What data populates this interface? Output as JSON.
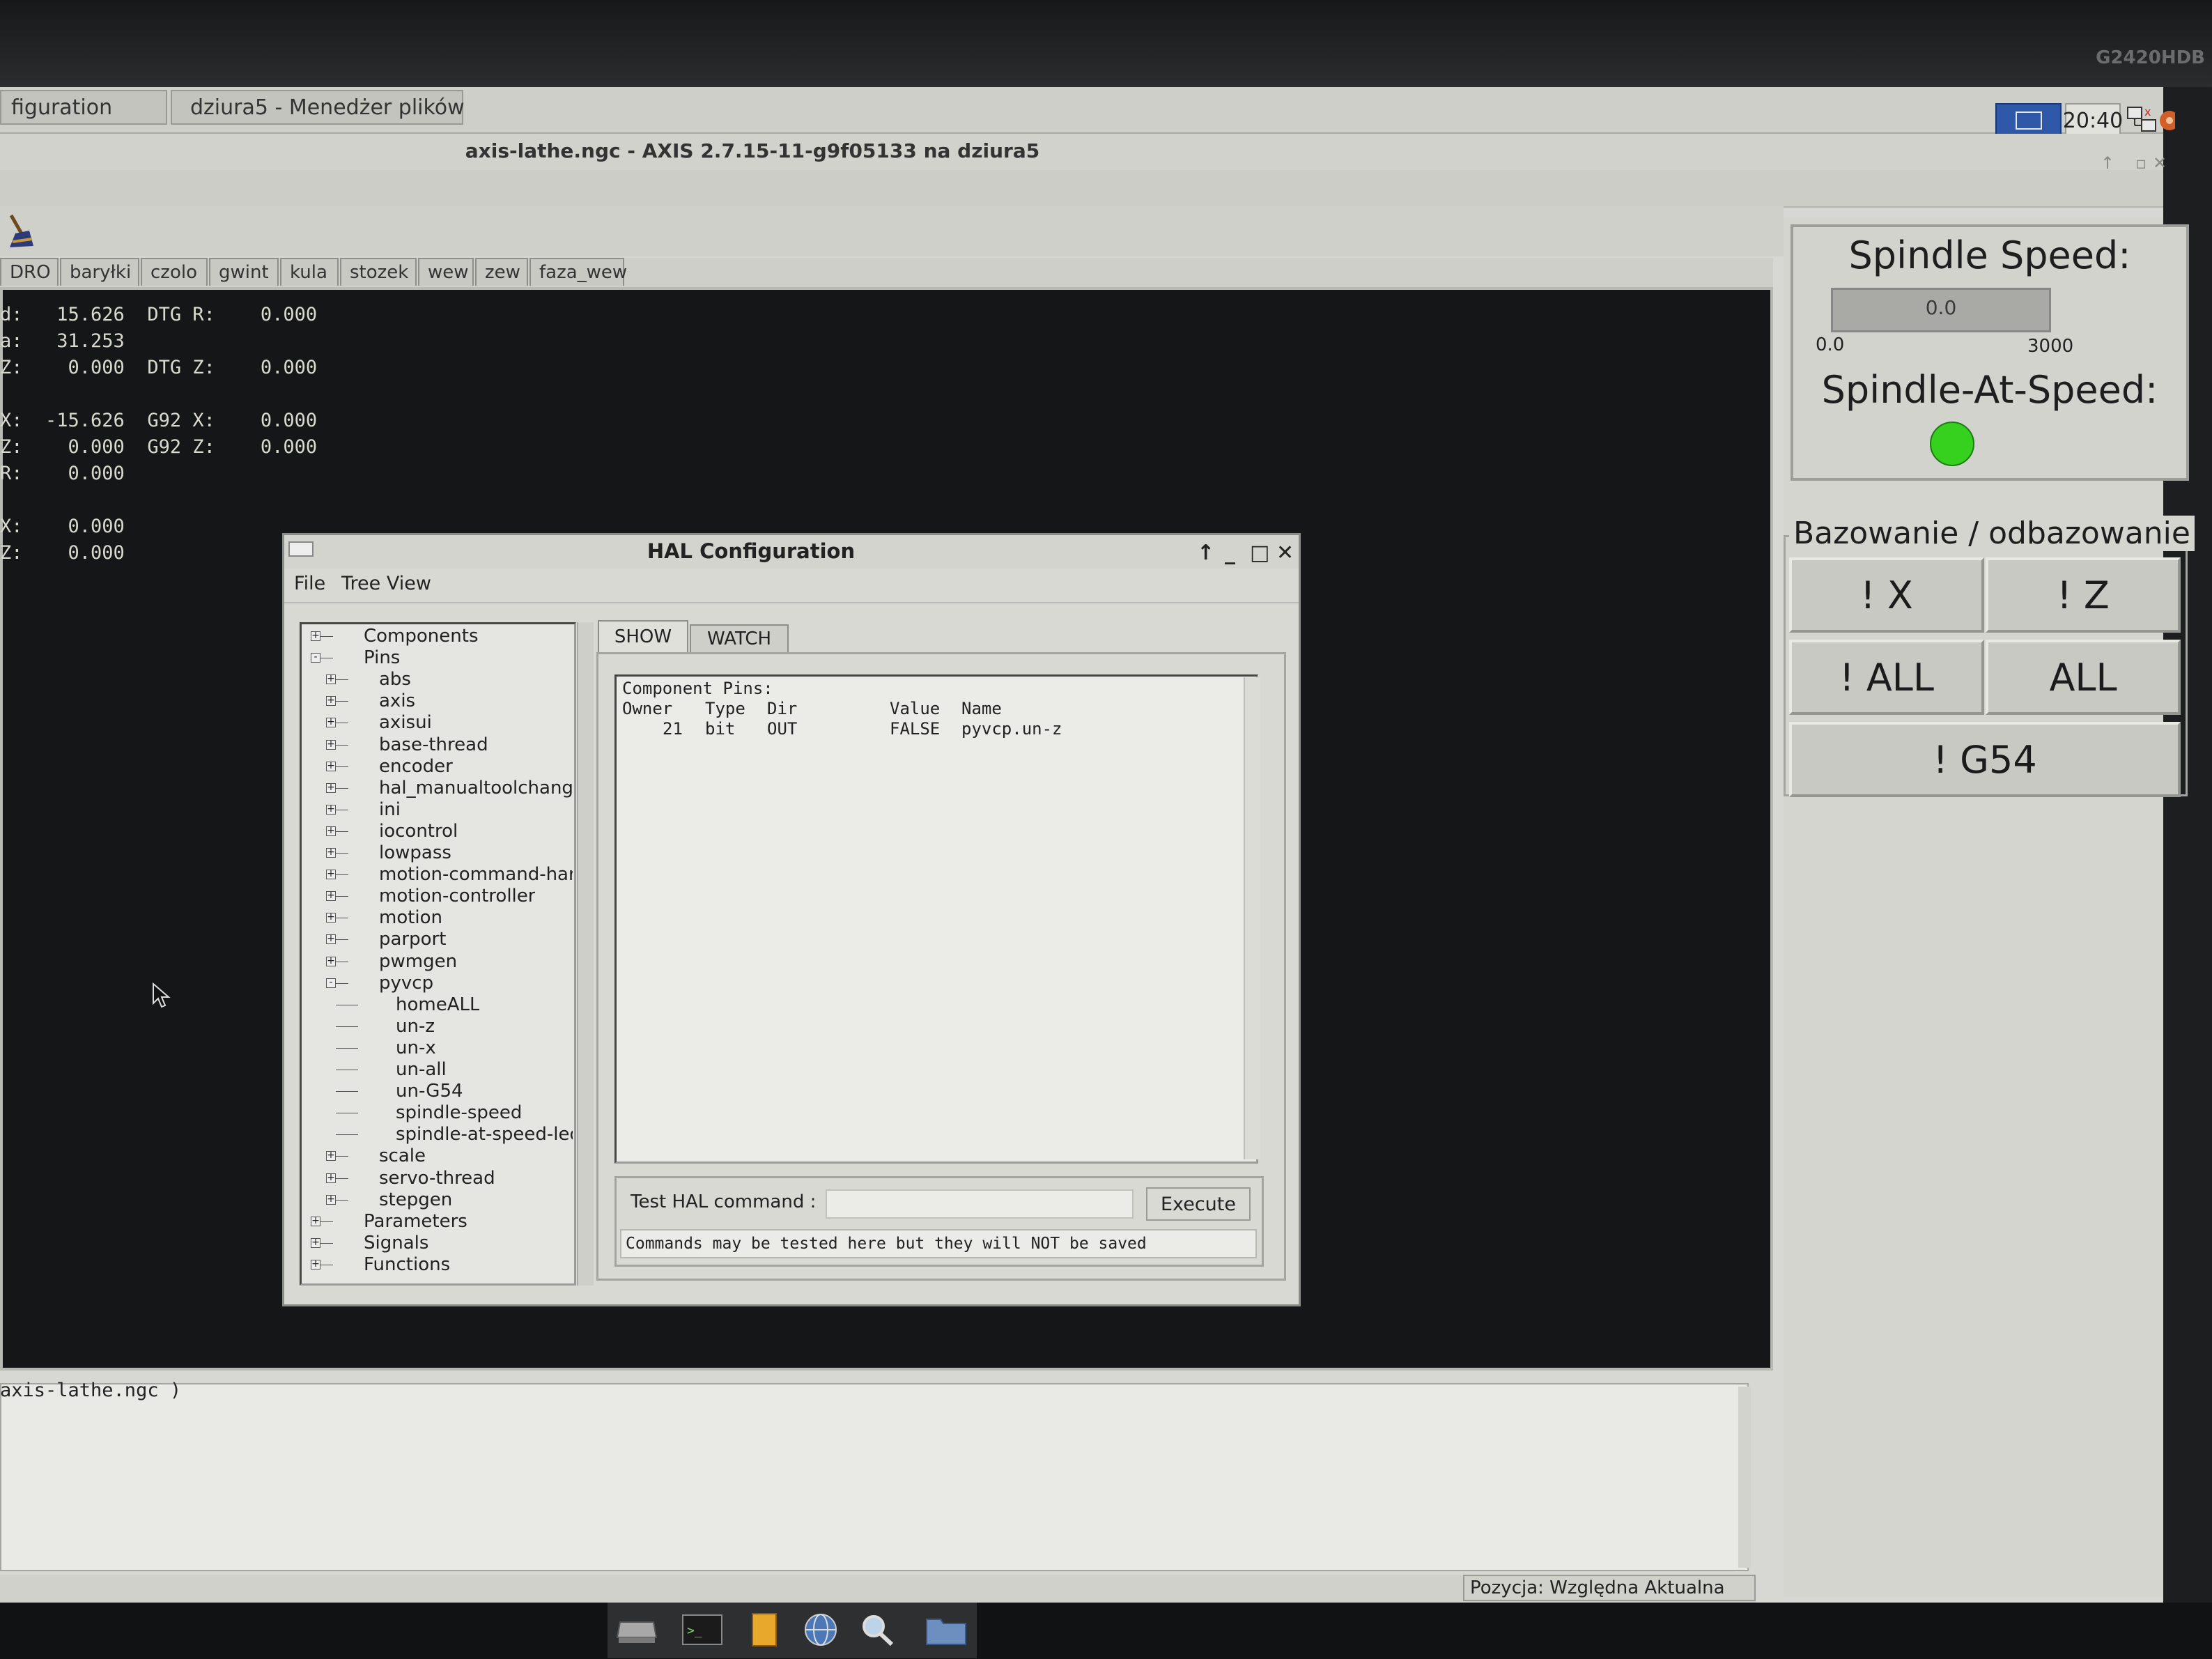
{
  "monitor": {
    "model_label": "G2420HDB"
  },
  "top_panel": {
    "tasks": [
      {
        "label": "figuration",
        "active": false
      },
      {
        "label": "dziura5 - Menedżer plików",
        "active": false
      }
    ],
    "clock": "20:40"
  },
  "axis": {
    "window_title": "axis-lathe.ngc - AXIS 2.7.15-11-g9f05133 na dziura5",
    "tabs": [
      "DRO",
      "baryłki",
      "czolo",
      "gwint",
      "kula",
      "stozek",
      "wew",
      "zew",
      "faza_wew"
    ],
    "dro_lines": [
      "d:   15.626  DTG R:    0.000",
      "a:   31.253",
      "Z:    0.000  DTG Z:    0.000",
      "",
      "X:  -15.626  G92 X:    0.000",
      "Z:    0.000  G92 Z:    0.000",
      "R:    0.000",
      "",
      "X:    0.000",
      "Z:    0.000"
    ],
    "gcode_text": "axis-lathe.ngc )",
    "status_position": "Pozycja: Względna Aktualna"
  },
  "pyvcp": {
    "spindle_speed_title": "Spindle Speed:",
    "spindle_speed_value": "0.0",
    "spindle_speed_min": "0.0",
    "spindle_speed_max": "3000",
    "spindle_at_speed_title": "Spindle-At-Speed:",
    "led_color": "#36d01e",
    "homing_title": "Bazowanie / odbazowanie",
    "buttons": {
      "unhome_x": "! X",
      "unhome_z": "! Z",
      "unhome_all": "! ALL",
      "home_all": "ALL",
      "g54": "! G54"
    }
  },
  "hal": {
    "title": "HAL Configuration",
    "menu": [
      "File",
      "Tree View"
    ],
    "tabs": {
      "show": "SHOW",
      "watch": "WATCH"
    },
    "tree": [
      {
        "label": "Components",
        "level": 0,
        "expander": "+"
      },
      {
        "label": "Pins",
        "level": 0,
        "expander": "-"
      },
      {
        "label": "abs",
        "level": 1,
        "expander": "+"
      },
      {
        "label": "axis",
        "level": 1,
        "expander": "+"
      },
      {
        "label": "axisui",
        "level": 1,
        "expander": "+"
      },
      {
        "label": "base-thread",
        "level": 1,
        "expander": "+"
      },
      {
        "label": "encoder",
        "level": 1,
        "expander": "+"
      },
      {
        "label": "hal_manualtoolchang",
        "level": 1,
        "expander": "+"
      },
      {
        "label": "ini",
        "level": 1,
        "expander": "+"
      },
      {
        "label": "iocontrol",
        "level": 1,
        "expander": "+"
      },
      {
        "label": "lowpass",
        "level": 1,
        "expander": "+"
      },
      {
        "label": "motion-command-har",
        "level": 1,
        "expander": "+"
      },
      {
        "label": "motion-controller",
        "level": 1,
        "expander": "+"
      },
      {
        "label": "motion",
        "level": 1,
        "expander": "+"
      },
      {
        "label": "parport",
        "level": 1,
        "expander": "+"
      },
      {
        "label": "pwmgen",
        "level": 1,
        "expander": "+"
      },
      {
        "label": "pyvcp",
        "level": 1,
        "expander": "-"
      },
      {
        "label": "homeALL",
        "level": 2,
        "expander": ""
      },
      {
        "label": "un-z",
        "level": 2,
        "expander": ""
      },
      {
        "label": "un-x",
        "level": 2,
        "expander": ""
      },
      {
        "label": "un-all",
        "level": 2,
        "expander": ""
      },
      {
        "label": "un-G54",
        "level": 2,
        "expander": ""
      },
      {
        "label": "spindle-speed",
        "level": 2,
        "expander": ""
      },
      {
        "label": "spindle-at-speed-led",
        "level": 2,
        "expander": ""
      },
      {
        "label": "scale",
        "level": 1,
        "expander": "+"
      },
      {
        "label": "servo-thread",
        "level": 1,
        "expander": "+"
      },
      {
        "label": "stepgen",
        "level": 1,
        "expander": "+"
      },
      {
        "label": "Parameters",
        "level": 0,
        "expander": "+"
      },
      {
        "label": "Signals",
        "level": 0,
        "expander": "+"
      },
      {
        "label": "Functions",
        "level": 0,
        "expander": "+"
      }
    ],
    "pins": {
      "heading": "Component Pins:",
      "columns": [
        "Owner",
        "Type",
        "Dir",
        "Value",
        "Name"
      ],
      "rows": [
        {
          "owner": "21",
          "type": "bit",
          "dir": "OUT",
          "value": "FALSE",
          "name": "pyvcp.un-z"
        }
      ]
    },
    "command_label": "Test HAL command :",
    "command_value": "",
    "execute_label": "Execute",
    "command_note": "Commands may be tested here but they will NOT be saved"
  },
  "taskbar": {
    "icons": [
      "drive-icon",
      "terminal-icon",
      "notes-icon",
      "globe-icon",
      "search-icon",
      "folder-icon"
    ]
  }
}
